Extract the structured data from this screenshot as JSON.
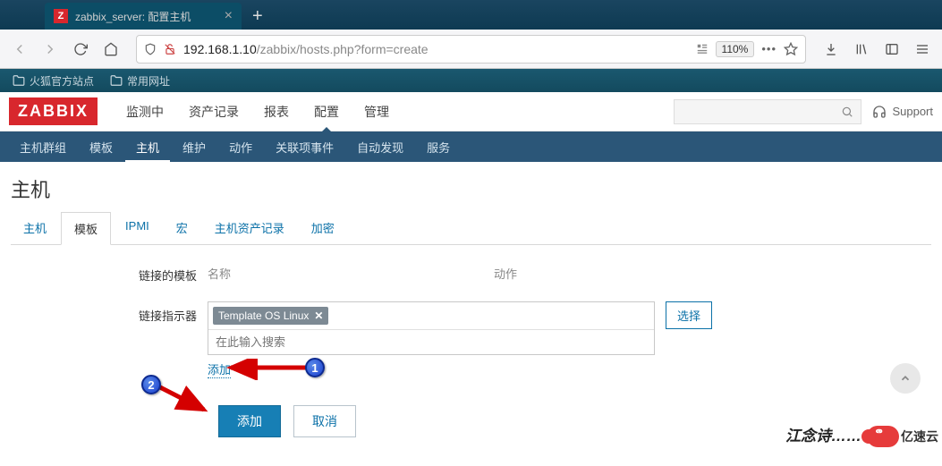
{
  "browser": {
    "tab_title": "zabbix_server: 配置主机",
    "favicon_letter": "Z",
    "url_host": "192.168.1.10",
    "url_path": "/zabbix/hosts.php?form=create",
    "zoom": "110%",
    "bookmarks": {
      "b1": "火狐官方站点",
      "b2": "常用网址"
    }
  },
  "topnav": {
    "logo": "ZABBIX",
    "items": {
      "i0": "监测中",
      "i1": "资产记录",
      "i2": "报表",
      "i3": "配置",
      "i4": "管理"
    },
    "support": "Support"
  },
  "subnav": {
    "i0": "主机群组",
    "i1": "模板",
    "i2": "主机",
    "i3": "维护",
    "i4": "动作",
    "i5": "关联项事件",
    "i6": "自动发现",
    "i7": "服务"
  },
  "page": {
    "title": "主机"
  },
  "form_tabs": {
    "t0": "主机",
    "t1": "模板",
    "t2": "IPMI",
    "t3": "宏",
    "t4": "主机资产记录",
    "t5": "加密"
  },
  "form": {
    "linked_label": "链接的模板",
    "col_name": "名称",
    "col_action": "动作",
    "linker_label": "链接指示器",
    "template_tag": "Template OS Linux",
    "search_placeholder": "在此输入搜索",
    "select_btn": "选择",
    "add_link": "添加",
    "btn_add": "添加",
    "btn_cancel": "取消"
  },
  "annotations": {
    "m1": "1",
    "m2": "2"
  },
  "watermark": {
    "text_partial": "江念诗……",
    "brand": "亿速云",
    "cloud_glyph": "ຶ"
  }
}
